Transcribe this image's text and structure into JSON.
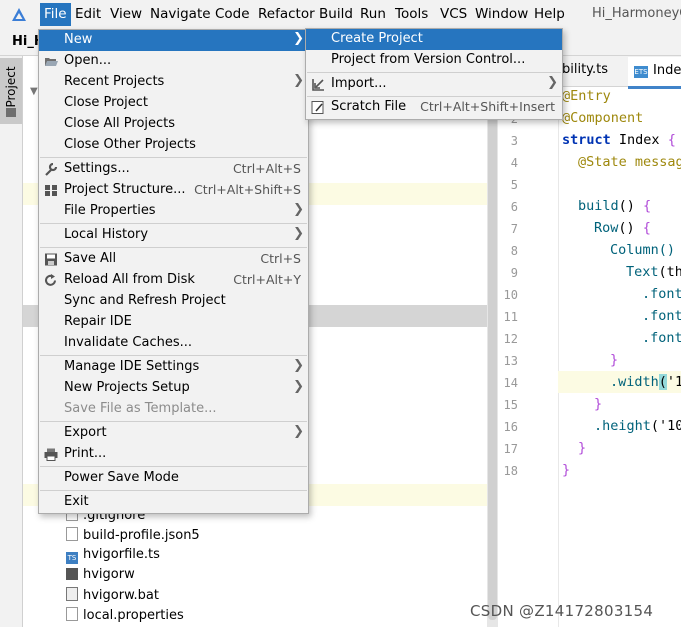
{
  "menubar": {
    "items": [
      "File",
      "Edit",
      "View",
      "Navigate",
      "Code",
      "Refactor",
      "Build",
      "Run",
      "Tools",
      "VCS",
      "Window",
      "Help"
    ],
    "window_title": "Hi_HarmoneyOS"
  },
  "project": {
    "name": "Hi_H",
    "tool_tab": "Project"
  },
  "file_menu": {
    "items": [
      {
        "label": "New",
        "shortcut": "",
        "submenu": true,
        "selected": true
      },
      {
        "label": "Open...",
        "shortcut": "",
        "icon": "folder-open-icon"
      },
      {
        "label": "Recent Projects",
        "shortcut": "",
        "submenu": true
      },
      {
        "label": "Close Project",
        "shortcut": ""
      },
      {
        "label": "Close All Projects",
        "shortcut": ""
      },
      {
        "label": "Close Other Projects",
        "shortcut": ""
      },
      {
        "label": "Settings...",
        "shortcut": "Ctrl+Alt+S",
        "icon": "wrench-icon"
      },
      {
        "label": "Project Structure...",
        "shortcut": "Ctrl+Alt+Shift+S",
        "icon": "project-structure-icon"
      },
      {
        "label": "File Properties",
        "shortcut": "",
        "submenu": true
      },
      {
        "label": "Local History",
        "shortcut": "",
        "submenu": true
      },
      {
        "label": "Save All",
        "shortcut": "Ctrl+S",
        "icon": "save-icon"
      },
      {
        "label": "Reload All from Disk",
        "shortcut": "Ctrl+Alt+Y",
        "icon": "reload-icon"
      },
      {
        "label": "Sync and Refresh Project",
        "shortcut": ""
      },
      {
        "label": "Repair IDE",
        "shortcut": ""
      },
      {
        "label": "Invalidate Caches...",
        "shortcut": ""
      },
      {
        "label": "Manage IDE Settings",
        "shortcut": "",
        "submenu": true
      },
      {
        "label": "New Projects Setup",
        "shortcut": "",
        "submenu": true
      },
      {
        "label": "Save File as Template...",
        "shortcut": "",
        "disabled": true
      },
      {
        "label": "Export",
        "shortcut": "",
        "submenu": true
      },
      {
        "label": "Print...",
        "shortcut": "",
        "icon": "print-icon"
      },
      {
        "label": "Power Save Mode",
        "shortcut": ""
      },
      {
        "label": "Exit",
        "shortcut": ""
      }
    ]
  },
  "new_submenu": {
    "items": [
      {
        "label": "Create Project",
        "shortcut": "",
        "selected": true
      },
      {
        "label": "Project from Version Control...",
        "shortcut": ""
      },
      {
        "label": "Import...",
        "shortcut": "",
        "submenu": true,
        "icon": "import-icon"
      },
      {
        "label": "Scratch File",
        "shortcut": "Ctrl+Alt+Shift+Insert",
        "icon": "scratch-file-icon"
      }
    ]
  },
  "tree": {
    "files": [
      ".gitignore",
      "build-profile.json5",
      "hvigorfile.ts",
      "hvigorw",
      "hvigorw.bat",
      "local.properties"
    ]
  },
  "editor": {
    "tabs": [
      "bility.ts",
      "Index"
    ],
    "line_numbers": [
      "2",
      "3",
      "4",
      "5",
      "6",
      "7",
      "8",
      "9",
      "10",
      "11",
      "12",
      "13",
      "14",
      "15",
      "16",
      "17",
      "18"
    ],
    "code": {
      "l1": "@Entry",
      "l2": "@Component",
      "l3_kw": "struct",
      "l3_name": " Index ",
      "l3_br": "{",
      "l4": "@State messag",
      "l6_fn": "build",
      "l6_rest": "() ",
      "l6_br": "{",
      "l7_fn": "Row",
      "l7_rest": "() ",
      "l7_br": "{",
      "l8": "Column()",
      "l9_fn": "Text",
      "l9_rest": "(th",
      "l10": ".font",
      "l11": ".font",
      "l12": ".font",
      "l13": "}",
      "l14_fn": ".width",
      "l14_paren": "(",
      "l14_rest": "'1",
      "l15": "}",
      "l16_fn": ".height",
      "l16_rest": "('10",
      "l17": "}",
      "l18": "}"
    }
  },
  "watermark": "CSDN @Z14172803154",
  "colors": {
    "accent": "#2675bf",
    "menu_bg": "#f2f2f2"
  }
}
